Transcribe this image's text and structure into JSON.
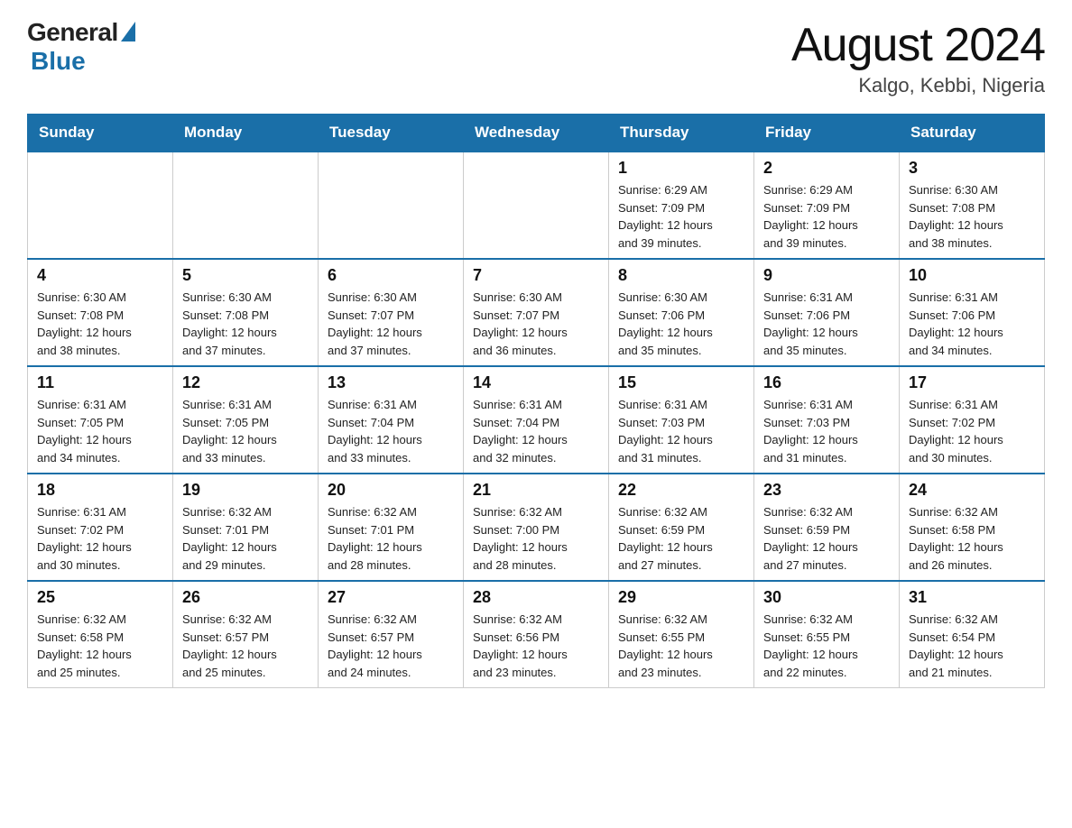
{
  "header": {
    "logo_general": "General",
    "logo_blue": "Blue",
    "month_title": "August 2024",
    "location": "Kalgo, Kebbi, Nigeria"
  },
  "weekdays": [
    "Sunday",
    "Monday",
    "Tuesday",
    "Wednesday",
    "Thursday",
    "Friday",
    "Saturday"
  ],
  "weeks": [
    [
      {
        "day": "",
        "info": ""
      },
      {
        "day": "",
        "info": ""
      },
      {
        "day": "",
        "info": ""
      },
      {
        "day": "",
        "info": ""
      },
      {
        "day": "1",
        "info": "Sunrise: 6:29 AM\nSunset: 7:09 PM\nDaylight: 12 hours\nand 39 minutes."
      },
      {
        "day": "2",
        "info": "Sunrise: 6:29 AM\nSunset: 7:09 PM\nDaylight: 12 hours\nand 39 minutes."
      },
      {
        "day": "3",
        "info": "Sunrise: 6:30 AM\nSunset: 7:08 PM\nDaylight: 12 hours\nand 38 minutes."
      }
    ],
    [
      {
        "day": "4",
        "info": "Sunrise: 6:30 AM\nSunset: 7:08 PM\nDaylight: 12 hours\nand 38 minutes."
      },
      {
        "day": "5",
        "info": "Sunrise: 6:30 AM\nSunset: 7:08 PM\nDaylight: 12 hours\nand 37 minutes."
      },
      {
        "day": "6",
        "info": "Sunrise: 6:30 AM\nSunset: 7:07 PM\nDaylight: 12 hours\nand 37 minutes."
      },
      {
        "day": "7",
        "info": "Sunrise: 6:30 AM\nSunset: 7:07 PM\nDaylight: 12 hours\nand 36 minutes."
      },
      {
        "day": "8",
        "info": "Sunrise: 6:30 AM\nSunset: 7:06 PM\nDaylight: 12 hours\nand 35 minutes."
      },
      {
        "day": "9",
        "info": "Sunrise: 6:31 AM\nSunset: 7:06 PM\nDaylight: 12 hours\nand 35 minutes."
      },
      {
        "day": "10",
        "info": "Sunrise: 6:31 AM\nSunset: 7:06 PM\nDaylight: 12 hours\nand 34 minutes."
      }
    ],
    [
      {
        "day": "11",
        "info": "Sunrise: 6:31 AM\nSunset: 7:05 PM\nDaylight: 12 hours\nand 34 minutes."
      },
      {
        "day": "12",
        "info": "Sunrise: 6:31 AM\nSunset: 7:05 PM\nDaylight: 12 hours\nand 33 minutes."
      },
      {
        "day": "13",
        "info": "Sunrise: 6:31 AM\nSunset: 7:04 PM\nDaylight: 12 hours\nand 33 minutes."
      },
      {
        "day": "14",
        "info": "Sunrise: 6:31 AM\nSunset: 7:04 PM\nDaylight: 12 hours\nand 32 minutes."
      },
      {
        "day": "15",
        "info": "Sunrise: 6:31 AM\nSunset: 7:03 PM\nDaylight: 12 hours\nand 31 minutes."
      },
      {
        "day": "16",
        "info": "Sunrise: 6:31 AM\nSunset: 7:03 PM\nDaylight: 12 hours\nand 31 minutes."
      },
      {
        "day": "17",
        "info": "Sunrise: 6:31 AM\nSunset: 7:02 PM\nDaylight: 12 hours\nand 30 minutes."
      }
    ],
    [
      {
        "day": "18",
        "info": "Sunrise: 6:31 AM\nSunset: 7:02 PM\nDaylight: 12 hours\nand 30 minutes."
      },
      {
        "day": "19",
        "info": "Sunrise: 6:32 AM\nSunset: 7:01 PM\nDaylight: 12 hours\nand 29 minutes."
      },
      {
        "day": "20",
        "info": "Sunrise: 6:32 AM\nSunset: 7:01 PM\nDaylight: 12 hours\nand 28 minutes."
      },
      {
        "day": "21",
        "info": "Sunrise: 6:32 AM\nSunset: 7:00 PM\nDaylight: 12 hours\nand 28 minutes."
      },
      {
        "day": "22",
        "info": "Sunrise: 6:32 AM\nSunset: 6:59 PM\nDaylight: 12 hours\nand 27 minutes."
      },
      {
        "day": "23",
        "info": "Sunrise: 6:32 AM\nSunset: 6:59 PM\nDaylight: 12 hours\nand 27 minutes."
      },
      {
        "day": "24",
        "info": "Sunrise: 6:32 AM\nSunset: 6:58 PM\nDaylight: 12 hours\nand 26 minutes."
      }
    ],
    [
      {
        "day": "25",
        "info": "Sunrise: 6:32 AM\nSunset: 6:58 PM\nDaylight: 12 hours\nand 25 minutes."
      },
      {
        "day": "26",
        "info": "Sunrise: 6:32 AM\nSunset: 6:57 PM\nDaylight: 12 hours\nand 25 minutes."
      },
      {
        "day": "27",
        "info": "Sunrise: 6:32 AM\nSunset: 6:57 PM\nDaylight: 12 hours\nand 24 minutes."
      },
      {
        "day": "28",
        "info": "Sunrise: 6:32 AM\nSunset: 6:56 PM\nDaylight: 12 hours\nand 23 minutes."
      },
      {
        "day": "29",
        "info": "Sunrise: 6:32 AM\nSunset: 6:55 PM\nDaylight: 12 hours\nand 23 minutes."
      },
      {
        "day": "30",
        "info": "Sunrise: 6:32 AM\nSunset: 6:55 PM\nDaylight: 12 hours\nand 22 minutes."
      },
      {
        "day": "31",
        "info": "Sunrise: 6:32 AM\nSunset: 6:54 PM\nDaylight: 12 hours\nand 21 minutes."
      }
    ]
  ]
}
